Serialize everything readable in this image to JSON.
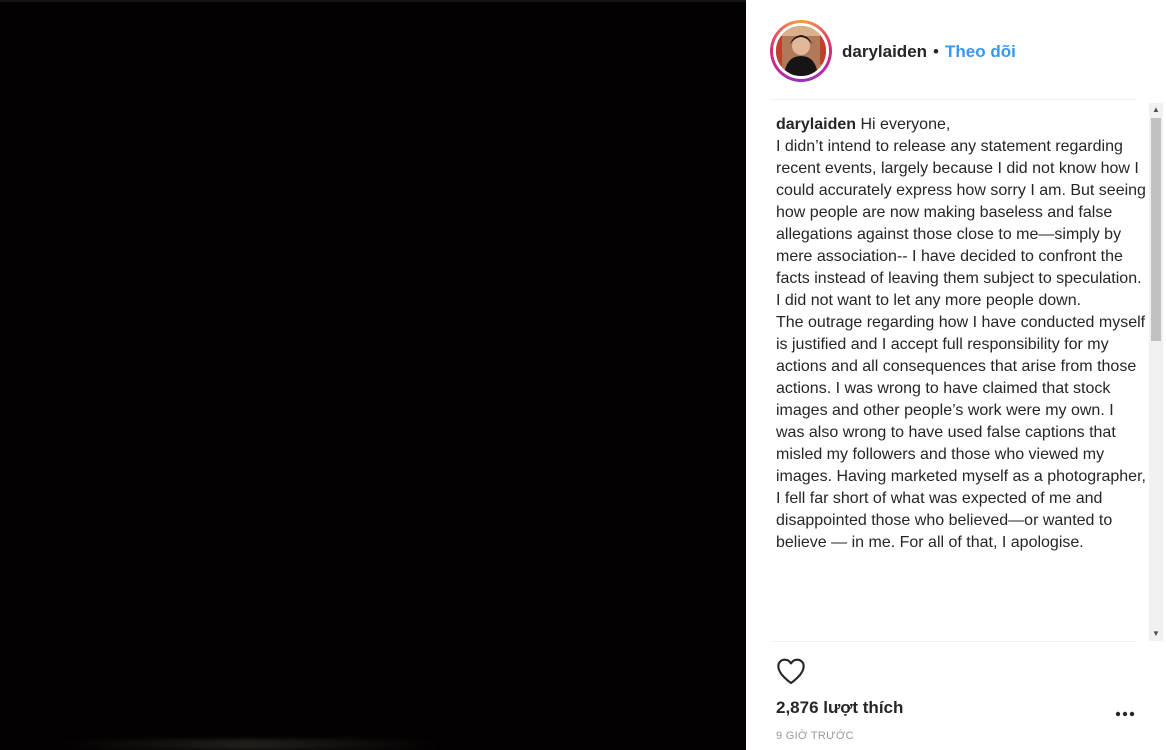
{
  "post": {
    "username": "darylaiden",
    "follow_label": "Theo dõi",
    "separator": "•",
    "caption_username": "darylaiden",
    "caption_lines": [
      "Hi everyone,",
      "I didn’t intend to release any statement regarding recent events, largely because I did not know how I could accurately express how sorry I am. But seeing how people are now making baseless and false allegations against those close to me—simply by mere association-- I have decided to confront the facts instead of leaving them subject to speculation. I did not want to let any more people down.",
      "The outrage regarding how I have conducted myself is justified and I accept full responsibility for my actions and all consequences that arise from those actions. I was wrong to have claimed that stock images and other people’s work were my own. I was also wrong to have used false captions that misled my followers and those who viewed my images. Having marketed myself as a photographer, I fell far short of what was expected of me and disappointed those who believed—or wanted to believe — in me. For all of that, I apologise."
    ],
    "likes_text": "2,876 lượt thích",
    "timestamp": "9 GIỜ TRƯỚC"
  },
  "icons": {
    "heart": "heart-icon",
    "more": "more-options-icon",
    "scroll_up": "scroll-up-arrow-icon",
    "scroll_down": "scroll-down-arrow-icon"
  },
  "colors": {
    "follow": "#3897f0",
    "text": "#262626",
    "muted": "#999999",
    "media_bg": "#030101"
  }
}
